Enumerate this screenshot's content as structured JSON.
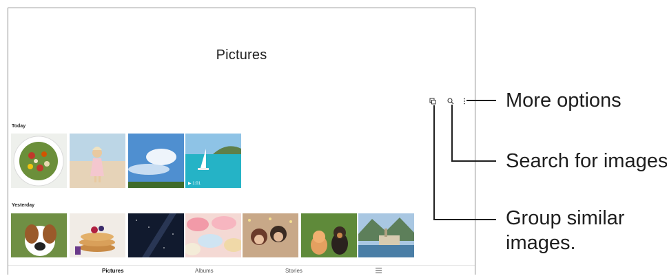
{
  "app": {
    "title": "Pictures"
  },
  "toolbar": {
    "icons": [
      "group-similar-icon",
      "search-icon",
      "more-options-icon"
    ]
  },
  "sections": [
    {
      "label": "Today",
      "thumbnails": [
        {
          "subject": "salad"
        },
        {
          "subject": "girl on beach"
        },
        {
          "subject": "blue sky"
        },
        {
          "subject": "sailboat",
          "video_duration": "1:01"
        }
      ]
    },
    {
      "label": "Yesterday",
      "thumbnails": [
        {
          "subject": "beagle"
        },
        {
          "subject": "pancakes"
        },
        {
          "subject": "milky way"
        },
        {
          "subject": "macarons"
        },
        {
          "subject": "friends"
        },
        {
          "subject": "kitten and puppy"
        },
        {
          "subject": "lakeside village"
        }
      ]
    }
  ],
  "bottom_nav": {
    "items": [
      "Pictures",
      "Albums",
      "Stories"
    ],
    "active": "Pictures",
    "menu_icon": "hamburger-icon"
  },
  "callouts": {
    "more_options": "More options",
    "search": "Search for images.",
    "group_line1": "Group similar",
    "group_line2": "images."
  },
  "colors": {
    "frame_border": "#8a8a8a",
    "callout": "#1e1e1e"
  }
}
